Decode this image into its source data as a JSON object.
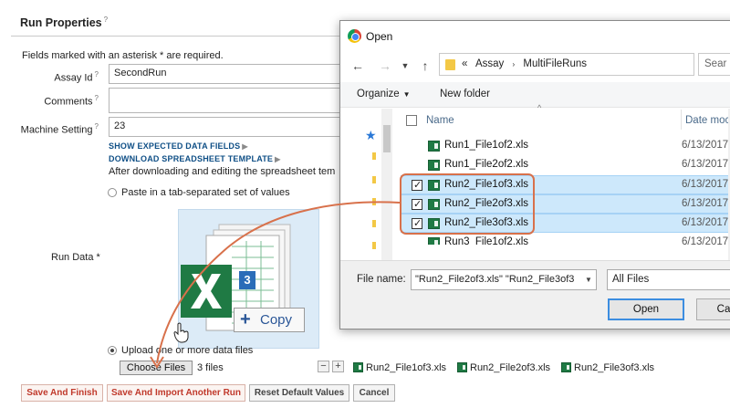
{
  "form": {
    "title": "Run Properties",
    "title_help": "?",
    "required_note": "Fields marked with an asterisk * are required.",
    "fields": {
      "assay_id_label": "Assay Id",
      "assay_id_value": "SecondRun",
      "comments_label": "Comments",
      "comments_value": "",
      "machine_setting_label": "Machine Setting",
      "machine_setting_value": "23"
    },
    "show_expected_link": "SHOW EXPECTED DATA FIELDS",
    "download_template_link": "DOWNLOAD SPREADSHEET TEMPLATE",
    "after_download_text": "After downloading and editing the spreadsheet tem",
    "paste_option": "Paste in a tab-separated set of values",
    "run_data_label": "Run Data *",
    "upload_option": "Upload one or more data files",
    "choose_files_button": "Choose Files",
    "files_count": "3 files",
    "uploaded_files": [
      "Run2_File1of3.xls",
      "Run2_File2of3.xls",
      "Run2_File3of3.xls"
    ],
    "copy_badge": "Copy",
    "excel_badge_number": "3",
    "buttons": {
      "save_finish": "Save And Finish",
      "save_import": "Save And Import Another Run",
      "reset": "Reset Default Values",
      "cancel": "Cancel"
    }
  },
  "dialog": {
    "title": "Open",
    "address": {
      "prefix": "«",
      "crumbs": [
        "Assay",
        "MultiFileRuns"
      ]
    },
    "search_placeholder": "Sear",
    "toolbar": {
      "organize": "Organize",
      "new_folder": "New folder"
    },
    "columns": {
      "name": "Name",
      "date": "Date moc"
    },
    "files": [
      {
        "name": "Run1_File1of2.xls",
        "date": "6/13/2017",
        "selected": false
      },
      {
        "name": "Run1_File2of2.xls",
        "date": "6/13/2017",
        "selected": false
      },
      {
        "name": "Run2_File1of3.xls",
        "date": "6/13/2017",
        "selected": true
      },
      {
        "name": "Run2_File2of3.xls",
        "date": "6/13/2017",
        "selected": true
      },
      {
        "name": "Run2_File3of3.xls",
        "date": "6/13/2017",
        "selected": true
      },
      {
        "name": "Run3_File1of2.xls",
        "date": "6/13/2017",
        "selected": false
      }
    ],
    "file_name_label": "File name:",
    "file_name_value": "\"Run2_File2of3.xls\" \"Run2_File3of3",
    "file_type": "All Files",
    "open_button": "Open",
    "cancel_button": "Ca"
  },
  "colors": {
    "accent_red": "#c0392b",
    "link_blue": "#0f4f86",
    "selection": "#cde8fb",
    "highlight_orange": "#d8714b",
    "excel_green": "#1f7a44"
  }
}
